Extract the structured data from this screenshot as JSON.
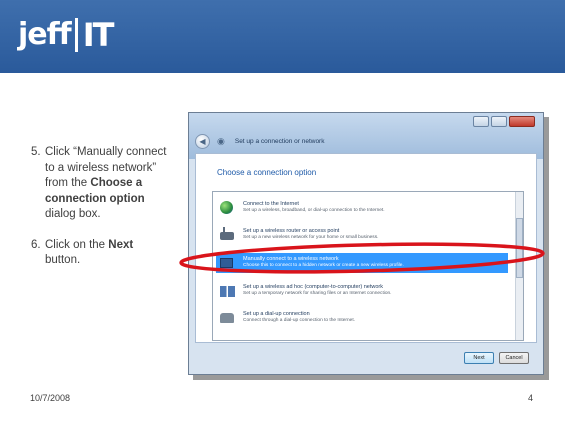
{
  "brand": {
    "name_left": "jeff",
    "name_right": "IT",
    "header_color": "#2e5f9f"
  },
  "steps": [
    {
      "num": "5.",
      "pre": "Click “Manually connect to a wireless network” from the ",
      "bold": "Choose a connection option",
      "post": " dialog box."
    },
    {
      "num": "6.",
      "pre": "Click on the ",
      "bold": "Next",
      "post": " button."
    }
  ],
  "dialog": {
    "nav_title": "Set up a connection or network",
    "heading": "Choose a connection option",
    "options": [
      {
        "title": "Connect to the Internet",
        "desc": "Set up a wireless, broadband, or dial-up connection to the Internet.",
        "icon": "globe-icon",
        "selected": false
      },
      {
        "title": "Set up a wireless router or access point",
        "desc": "Set up a new wireless network for your home or small business.",
        "icon": "router-icon",
        "selected": false
      },
      {
        "title": "Manually connect to a wireless network",
        "desc": "Choose this to connect to a hidden network or create a new wireless profile.",
        "icon": "computer-icon",
        "selected": true
      },
      {
        "title": "Set up a wireless ad hoc (computer-to-computer) network",
        "desc": "Set up a temporary network for sharing files or an Internet connection.",
        "icon": "adhoc-network-icon",
        "selected": false
      },
      {
        "title": "Set up a dial-up connection",
        "desc": "Connect through a dial-up connection to the Internet.",
        "icon": "dialup-icon",
        "selected": false
      }
    ],
    "next_label": "Next",
    "cancel_label": "Cancel",
    "highlight_color": "#d9141b",
    "selection_color": "#3399ff"
  },
  "footer": {
    "date": "10/7/2008",
    "page": "4"
  }
}
